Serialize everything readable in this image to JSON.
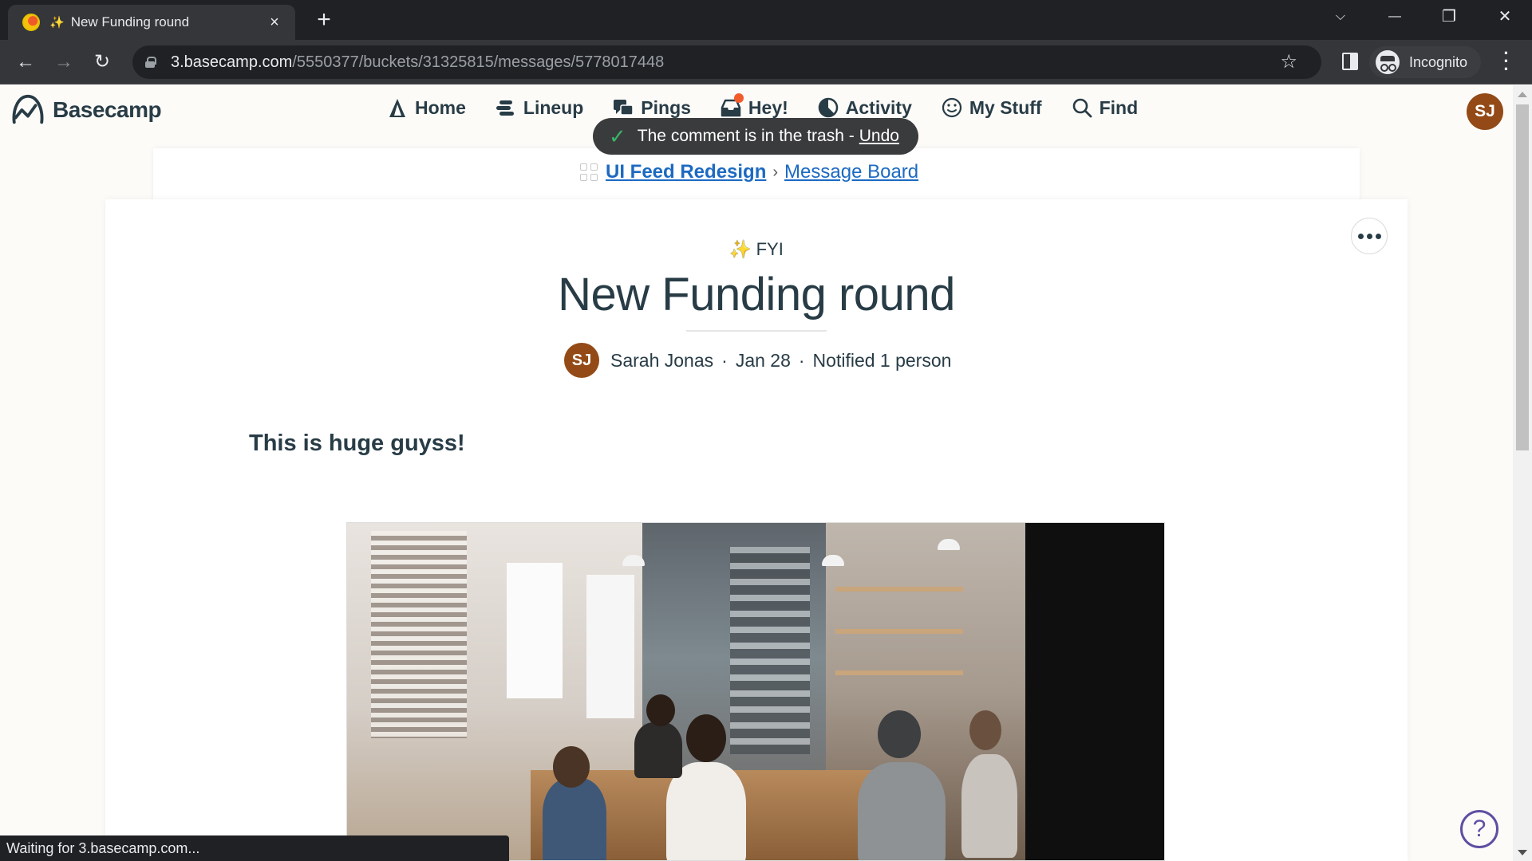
{
  "browser": {
    "tab": {
      "favicon": "basecamp-favicon",
      "emoji": "✨",
      "title": "New Funding round",
      "close_icon": "×"
    },
    "new_tab_icon": "+",
    "window_controls": {
      "tab_search": "⌵",
      "minimize": "—",
      "restore": "❐",
      "close": "✕"
    },
    "nav": {
      "back": "←",
      "forward": "→",
      "reload": "↻"
    },
    "url": {
      "host": "3.basecamp.com",
      "path": "/5550377/buckets/31325815/messages/5778017448"
    },
    "bookmark_icon": "☆",
    "profile_label": "Incognito",
    "menu_icon": "⋮",
    "status_text": "Waiting for 3.basecamp.com..."
  },
  "app": {
    "brand": "Basecamp",
    "nav": [
      {
        "id": "home",
        "label": "Home",
        "icon": "home-icon"
      },
      {
        "id": "lineup",
        "label": "Lineup",
        "icon": "lineup-icon"
      },
      {
        "id": "pings",
        "label": "Pings",
        "icon": "pings-icon"
      },
      {
        "id": "hey",
        "label": "Hey!",
        "icon": "hey-inbox-icon",
        "has_notification": true
      },
      {
        "id": "activity",
        "label": "Activity",
        "icon": "activity-icon"
      },
      {
        "id": "mystuff",
        "label": "My Stuff",
        "icon": "smiley-icon"
      },
      {
        "id": "find",
        "label": "Find",
        "icon": "search-icon"
      }
    ],
    "user_initials": "SJ",
    "colors": {
      "avatar": "#934a16",
      "link": "#1c6ac2",
      "text": "#283c46",
      "notification": "#f25c2b",
      "help": "#5e4fa2",
      "toast_check": "#3bb36a"
    }
  },
  "toast": {
    "message": "The comment is in the trash -",
    "action": "Undo"
  },
  "breadcrumb": {
    "project": "UI Feed Redesign",
    "separator": "›",
    "board": "Message Board"
  },
  "message": {
    "category_emoji": "✨",
    "category": "FYI",
    "title": "New Funding round",
    "author_initials": "SJ",
    "author": "Sarah Jonas",
    "date": "Jan 28",
    "notified": "Notified 1 person",
    "separator": "·",
    "body_heading": "This is huge guyss!",
    "image_alt": "Team meeting around a table in an office kitchen"
  },
  "help_icon": "?"
}
